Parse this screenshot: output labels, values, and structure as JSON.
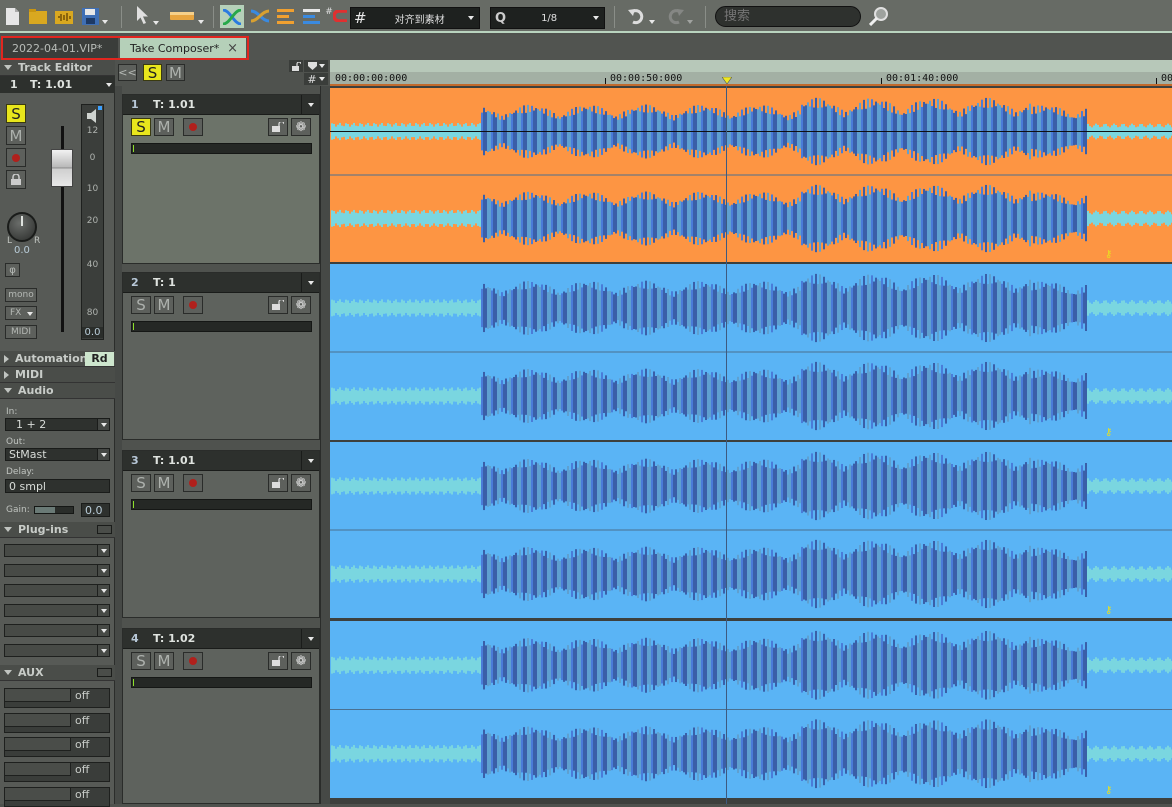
{
  "toolbar": {
    "icons": [
      "new-file-icon",
      "open-folder-icon",
      "audio-folder-icon",
      "save-icon",
      "pointer-tool-icon",
      "range-tool-icon",
      "crossfade-icon",
      "crossfade-alt-icon",
      "tracks-orange-icon",
      "tracks-blue-icon",
      "snap-magnet-icon",
      "grid-icon"
    ],
    "snap_mode": "对齐到素材",
    "quantize_value": "1/8",
    "search_placeholder": "搜索"
  },
  "tabs": [
    {
      "label": "2022-04-01.VIP*",
      "active": false
    },
    {
      "label": "Take Composer*",
      "active": true,
      "close": "×"
    }
  ],
  "inspector": {
    "title": "Track Editor",
    "track_number": "1",
    "track_name": "T: 1.01",
    "solo": "S",
    "mute": "M",
    "fader_scale": [
      "12",
      "0",
      "10",
      "20",
      "40",
      "80"
    ],
    "fader_readout": "0.0",
    "pan_left": "L",
    "pan_right": "R",
    "pan_value": "0.0",
    "phase_label": "φ",
    "mono_label": "mono",
    "fx_label": "FX",
    "midi_label": "MIDI",
    "sections": {
      "automation": "Automation",
      "automation_mode": "Rd",
      "midi": "MIDI",
      "audio": "Audio",
      "plugins": "Plug-ins",
      "aux": "AUX"
    },
    "audio": {
      "in_label": "In:",
      "in_value": "1 + 2",
      "out_label": "Out:",
      "out_value": "StMast",
      "delay_label": "Delay:",
      "delay_value": "0 smpl",
      "gain_label": "Gain:",
      "gain_value": "0.0"
    },
    "plugin_slots": 6,
    "aux_sends": [
      "off",
      "off",
      "off",
      "off",
      "off"
    ]
  },
  "track_header_bar": {
    "collapse": "<<",
    "solo": "S",
    "mute": "M"
  },
  "tracks": [
    {
      "number": "1",
      "name": "T: 1.01",
      "solo": "S",
      "mute": "M",
      "solo_active": true,
      "lane_color": "#fd9543"
    },
    {
      "number": "2",
      "name": "T: 1",
      "solo": "S",
      "mute": "M",
      "solo_active": false,
      "lane_color": "#5ab4f5"
    },
    {
      "number": "3",
      "name": "T: 1.01",
      "solo": "S",
      "mute": "M",
      "solo_active": false,
      "lane_color": "#5ab4f5"
    },
    {
      "number": "4",
      "name": "T: 1.02",
      "solo": "S",
      "mute": "M",
      "solo_active": false,
      "lane_color": "#5ab4f5"
    }
  ],
  "ruler": {
    "labels": [
      "00:00:00:000",
      "00:00:50:000",
      "00:01:40:000",
      "00"
    ]
  },
  "colors": {
    "accent_solo": "#e8e61c",
    "selected_lane": "#fd9543",
    "lane": "#5ab4f5",
    "tab_active": "#b5d0b9",
    "highlight": "#e0261f"
  }
}
